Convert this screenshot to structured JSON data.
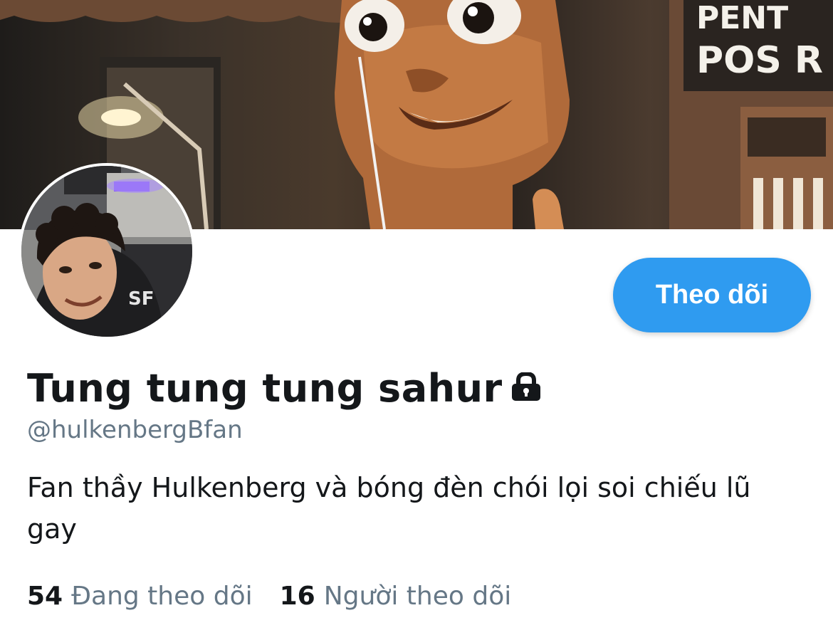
{
  "profile": {
    "display_name": "Tung tung tung sahur",
    "handle": "@hulkenbergBfan",
    "bio": "Fan thầy Hulkenberg và bóng đèn chói lọi soi chiếu lũ gay",
    "protected_icon": "lock-icon",
    "banner_sign_lines": [
      "PENT",
      "POS R"
    ]
  },
  "actions": {
    "follow_label": "Theo dõi"
  },
  "stats": {
    "following_count": "54",
    "following_label": "Đang theo dõi",
    "followers_count": "16",
    "followers_label": "Người theo dõi"
  },
  "colors": {
    "accent": "#2f9bf0",
    "text_primary": "#14171a",
    "text_secondary": "#657786"
  }
}
